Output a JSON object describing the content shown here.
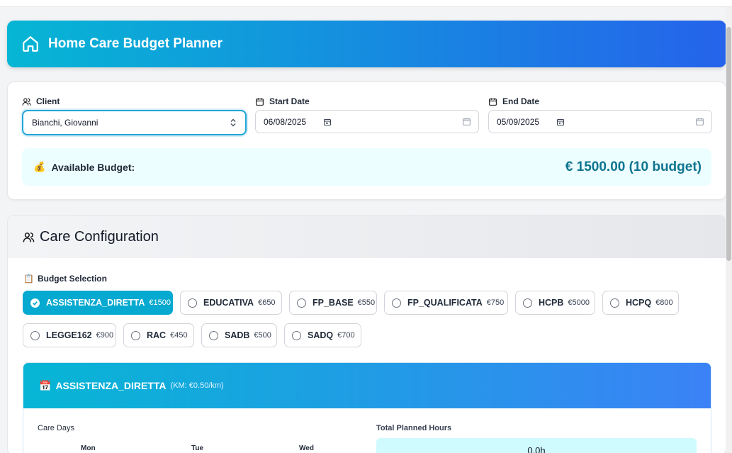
{
  "header": {
    "title": "Home Care Budget Planner"
  },
  "client": {
    "label": "Client",
    "value": "Bianchi, Giovanni"
  },
  "start_date": {
    "label": "Start Date",
    "value": "06/08/2025"
  },
  "end_date": {
    "label": "End Date",
    "value": "05/09/2025"
  },
  "budget": {
    "label": "Available Budget:",
    "amount": "€ 1500.00 (10 budget)"
  },
  "config": {
    "title": "Care Configuration",
    "selection_label": "Budget Selection",
    "options": [
      {
        "name": "ASSISTENZA_DIRETTA",
        "price": "€1500",
        "selected": true
      },
      {
        "name": "EDUCATIVA",
        "price": "€650",
        "selected": false
      },
      {
        "name": "FP_BASE",
        "price": "€550",
        "selected": false
      },
      {
        "name": "FP_QUALIFICATA",
        "price": "€750",
        "selected": false
      },
      {
        "name": "HCPB",
        "price": "€5000",
        "selected": false
      },
      {
        "name": "HCPQ",
        "price": "€800",
        "selected": false
      },
      {
        "name": "LEGGE162",
        "price": "€900",
        "selected": false
      },
      {
        "name": "RAC",
        "price": "€450",
        "selected": false
      },
      {
        "name": "SADB",
        "price": "€500",
        "selected": false
      },
      {
        "name": "SADQ",
        "price": "€700",
        "selected": false
      }
    ]
  },
  "service": {
    "name": "ASSISTENZA_DIRETTA",
    "km_rate": "(KM: €0.50/km)",
    "care_days_label": "Care Days",
    "days": [
      "Mon",
      "Tue",
      "Wed"
    ],
    "total_hours_label": "Total Planned Hours",
    "total_hours": "0.0h"
  },
  "colors": {
    "accent": "#06b6d4",
    "brand": "#2563eb",
    "amount": "#0e7490"
  }
}
